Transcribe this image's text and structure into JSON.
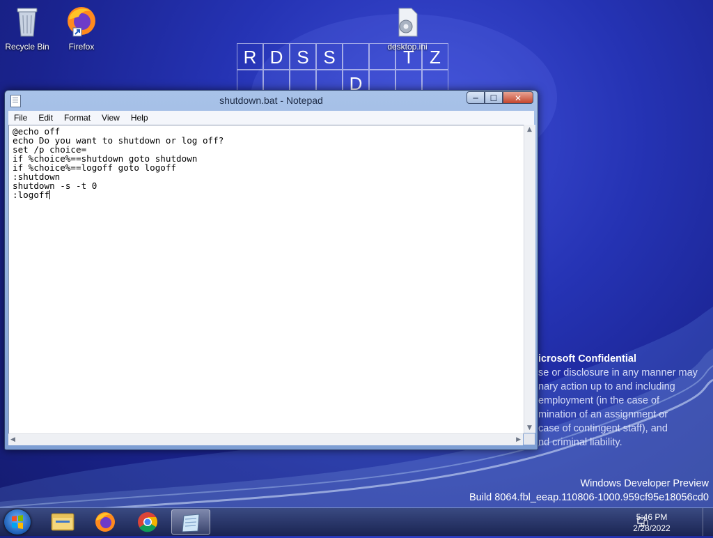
{
  "desktop": {
    "icons": [
      {
        "label": "Recycle Bin",
        "icon": "recycle-bin-icon"
      },
      {
        "label": "Firefox",
        "icon": "firefox-icon"
      },
      {
        "label": "desktop.ini",
        "icon": "settings-file-icon"
      }
    ],
    "tiles": [
      "R",
      "D",
      "S",
      "S",
      "",
      "",
      "T",
      "Z",
      "D"
    ],
    "watermark": {
      "heading": "icrosoft Confidential",
      "lines": [
        "se or disclosure in any manner may",
        "nary action up to and including",
        "employment (in the case of",
        "mination of an assignment or",
        "case of contingent staff), and",
        "nd criminal liability."
      ]
    },
    "build": {
      "line1": "Windows Developer Preview",
      "line2": "Build 8064.fbl_eeap.110806-1000.959cf95e18056cd0"
    }
  },
  "notepad": {
    "title": "shutdown.bat - Notepad",
    "menu": [
      "File",
      "Edit",
      "Format",
      "View",
      "Help"
    ],
    "content": "@echo off\necho Do you want to shutdown or log off?\nset /p choice=\nif %choice%==shutdown goto shutdown\nif %choice%==logoff goto logoff\n:shutdown\nshutdown -s -t 0\n:logoff",
    "buttons": {
      "minimize": "─",
      "maximize": "☐",
      "close": "✕"
    }
  },
  "taskbar": {
    "start_icon": "windows-start-icon",
    "apps": [
      "file-explorer-icon",
      "firefox-icon",
      "chrome-icon",
      "notepad-icon"
    ],
    "active_app": "notepad-icon",
    "tray_icon": "network-icon",
    "time": "5:46 PM",
    "date": "2/28/2022"
  }
}
